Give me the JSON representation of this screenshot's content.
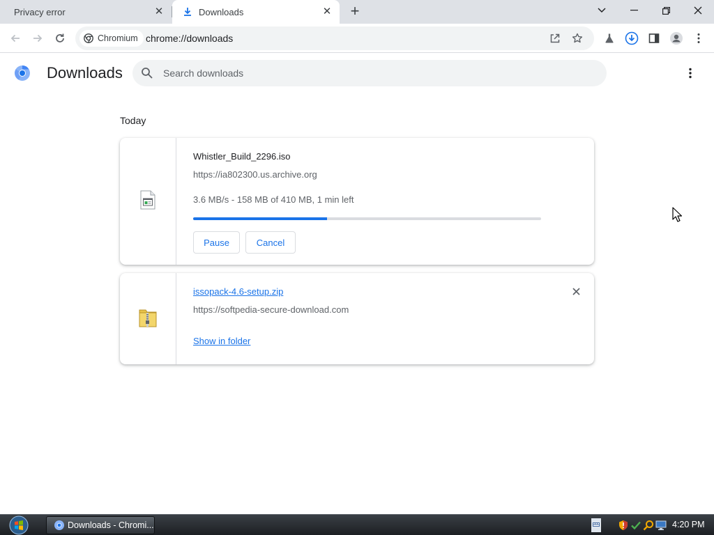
{
  "browser": {
    "tabs": [
      {
        "title": "Privacy error",
        "active": false
      },
      {
        "title": "Downloads",
        "active": true
      }
    ],
    "omnibox": {
      "chip_label": "Chromium",
      "url": "chrome://downloads"
    }
  },
  "page": {
    "title": "Downloads",
    "search_placeholder": "Search downloads",
    "date_heading": "Today"
  },
  "downloads": [
    {
      "file_name": "Whistler_Build_2296.iso",
      "url": "https://ia802300.us.archive.org",
      "status": "3.6 MB/s - 158 MB of 410 MB, 1 min left",
      "progress": 0.385,
      "pause_label": "Pause",
      "cancel_label": "Cancel",
      "icon": "disc-image-file-icon"
    },
    {
      "file_name": "issopack-4.6-setup.zip",
      "url": "https://softpedia-secure-download.com",
      "show_in_folder_label": "Show in folder",
      "icon": "zip-folder-icon"
    }
  ],
  "taskbar": {
    "task_label": "Downloads - Chromi...",
    "clock": "4:20 PM"
  },
  "colors": {
    "accent": "#1a73e8",
    "tab_strip": "#dee1e6",
    "omnibox_bg": "#f1f3f4"
  }
}
